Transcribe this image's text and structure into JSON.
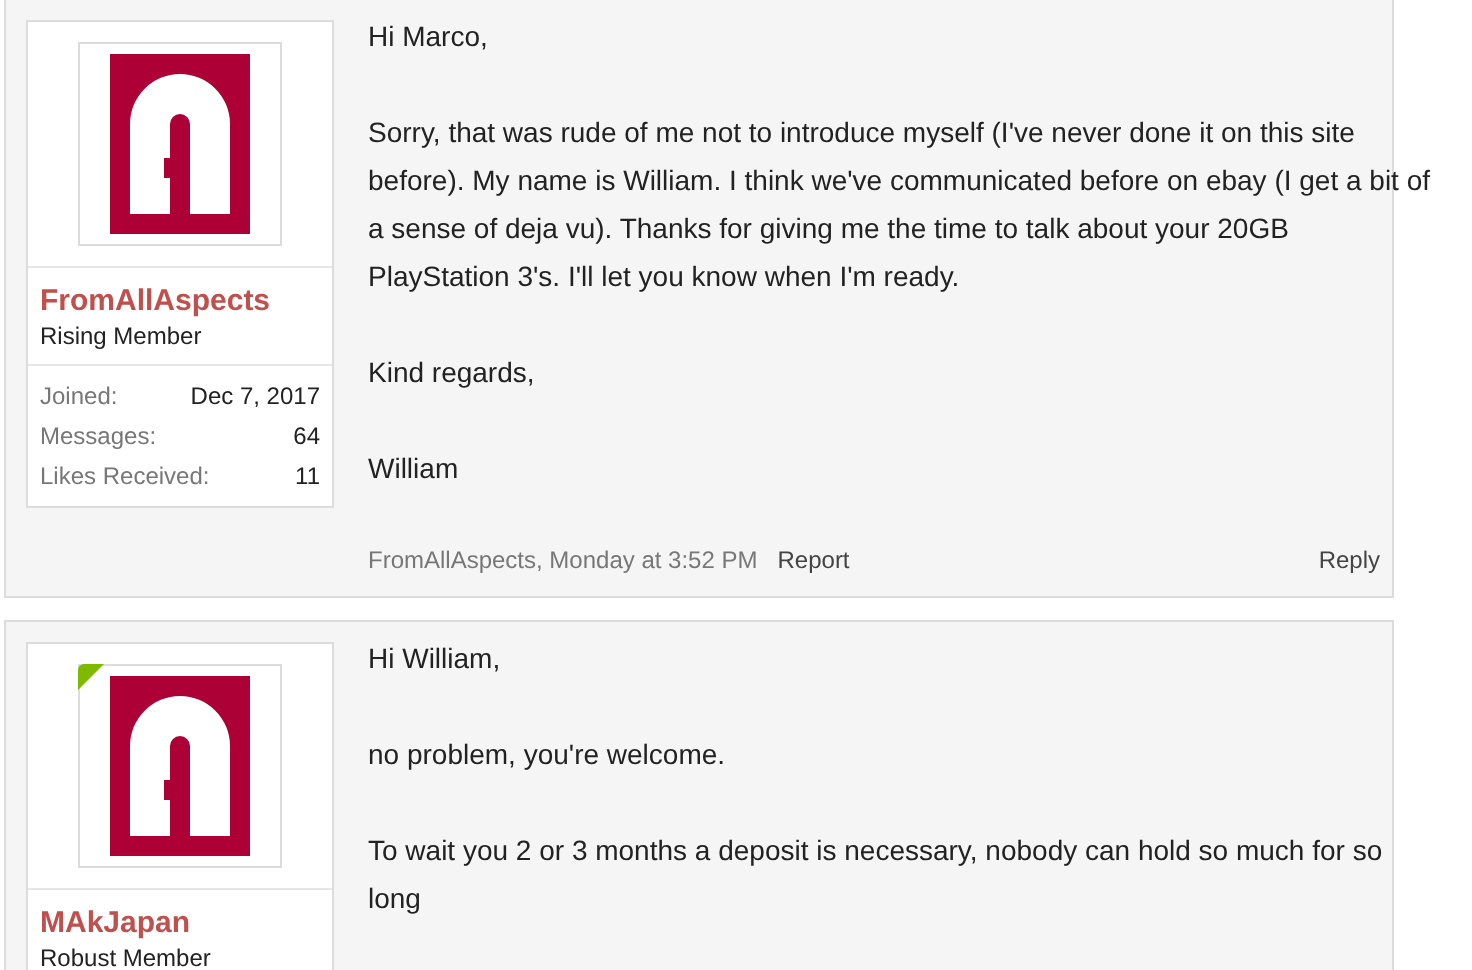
{
  "posts": [
    {
      "author": "FromAllAspects",
      "title": "Rising Member",
      "online": false,
      "stats": [
        {
          "label": "Joined:",
          "value": "Dec 7, 2017"
        },
        {
          "label": "Messages:",
          "value": "64"
        },
        {
          "label": "Likes Received:",
          "value": "11"
        }
      ],
      "paragraphs": [
        "Hi Marco,",
        "Sorry, that was rude of me not to introduce myself (I've never done it on this site before). My name is William. I think we've communicated before on ebay (I get a bit of a sense of deja vu). Thanks for giving me the time to talk about your 20GB PlayStation 3's. I'll let you know when I'm ready.",
        "Kind regards,",
        "William"
      ],
      "footer": {
        "meta": "FromAllAspects, Monday at 3:52 PM",
        "report": "Report",
        "reply": "Reply"
      }
    },
    {
      "author": "MAkJapan",
      "title": "Robust Member",
      "online": true,
      "paragraphs": [
        "Hi William,",
        "no problem, you're welcome.",
        "To wait you 2 or 3 months a deposit is necessary, nobody can hold so much for so long"
      ]
    }
  ]
}
